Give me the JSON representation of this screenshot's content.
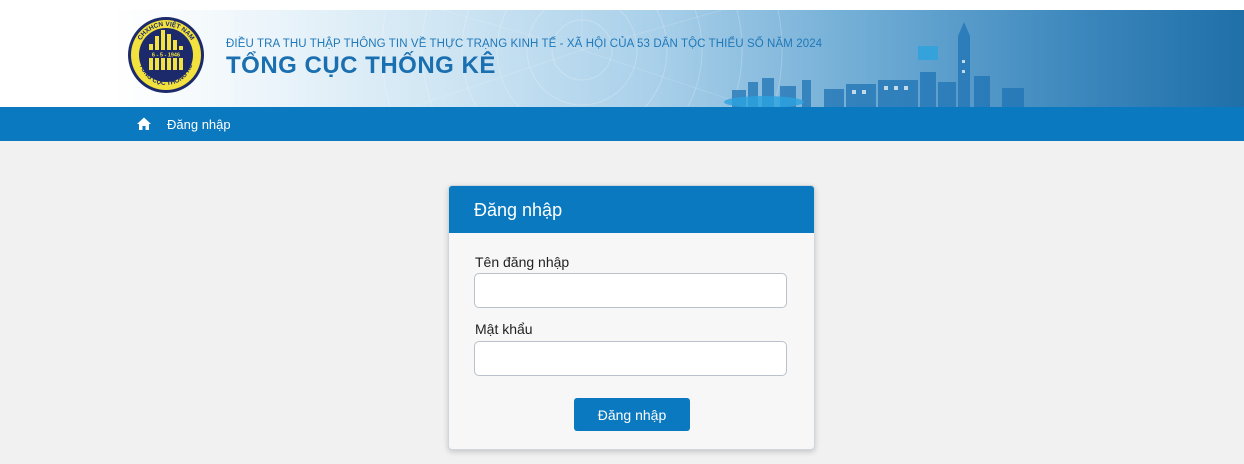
{
  "header": {
    "org_subtitle": "ĐIỀU TRA THU THẬP THÔNG TIN VỀ THỰC TRẠNG KINH TẾ - XÃ HỘI CỦA 53 DÂN TỘC THIỂU SỐ NĂM 2024",
    "org_title": "TỔNG CỤC THỐNG KÊ",
    "logo": {
      "top_text": "CHXHCN VIỆT NAM",
      "date_text": "6 - 5 - 1946",
      "bottom_text": "TỔNG CỤC THỐNG KÊ"
    }
  },
  "nav": {
    "home_icon": "home-icon",
    "link": "Đăng nhập"
  },
  "login": {
    "title": "Đăng nhập",
    "username_label": "Tên đăng nhập",
    "username_value": "",
    "password_label": "Mật khẩu",
    "password_value": "",
    "submit_label": "Đăng nhập"
  },
  "colors": {
    "primary": "#0a79bf",
    "background": "#f1f1f1",
    "logo_yellow": "#f3e23d",
    "logo_navy": "#1c2a6b"
  }
}
